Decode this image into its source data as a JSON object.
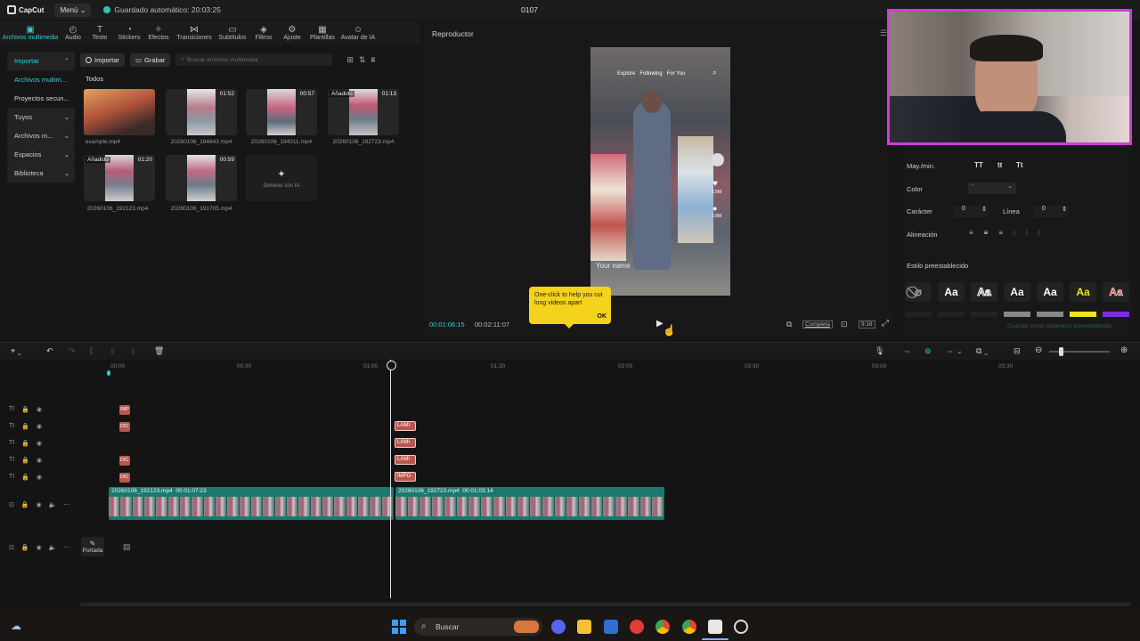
{
  "titlebar": {
    "app_name": "CapCut",
    "menu_label": "Menú",
    "autosave_text": "Guardado automático: 20:03:25",
    "project_title": "0107"
  },
  "toolbar": {
    "tools": [
      {
        "label": "Archivos multimedia",
        "icon": "media-icon"
      },
      {
        "label": "Audio",
        "icon": "audio-icon"
      },
      {
        "label": "Texto",
        "icon": "text-icon"
      },
      {
        "label": "Stickers",
        "icon": "sticker-icon"
      },
      {
        "label": "Efectos",
        "icon": "effects-icon"
      },
      {
        "label": "Transiciones",
        "icon": "transition-icon"
      },
      {
        "label": "Subtítulos",
        "icon": "subtitle-icon"
      },
      {
        "label": "Filtros",
        "icon": "filter-icon"
      },
      {
        "label": "Ajuste",
        "icon": "adjust-icon"
      },
      {
        "label": "Plantillas",
        "icon": "template-icon"
      },
      {
        "label": "Avatar de IA",
        "icon": "avatar-icon"
      }
    ]
  },
  "sidebar": {
    "import_label": "Importar",
    "media_label": "Archivos multim...",
    "secure_label": "Proyectos secun...",
    "yours_label": "Tuyos",
    "archives_label": "Archivos m...",
    "spaces_label": "Espacios",
    "library_label": "Biblioteca"
  },
  "media": {
    "import_btn": "Importar",
    "record_btn": "Grabar",
    "search_placeholder": "Buscar archivos multimedia",
    "section_label": "Todos",
    "items": [
      {
        "name": "example.mp4",
        "duration": "",
        "tag": ""
      },
      {
        "name": "20260106_194643.mp4",
        "duration": "01:52",
        "tag": ""
      },
      {
        "name": "20260106_194011.mp4",
        "duration": "00:57",
        "tag": ""
      },
      {
        "name": "20260106_192723.mp4",
        "duration": "01:13",
        "tag": "Añadido"
      },
      {
        "name": "20260106_192123.mp4",
        "duration": "01:20",
        "tag": "Añadido"
      },
      {
        "name": "20260106_191705.mp4",
        "duration": "00:59",
        "tag": ""
      }
    ],
    "generate_label": "Generar con IA"
  },
  "player": {
    "title": "Reproductor",
    "current_time": "00:01:06:15",
    "total_time": "00:02:11:07",
    "tooltip_text": "One-click to help you cut long videos apart",
    "tooltip_ok": "OK",
    "ratio_label": "Completa",
    "aspect_label": "9:16",
    "video_tabs": {
      "explore": "Explore",
      "following": "Following",
      "for_you": "For You"
    },
    "video_counts": {
      "likes": "2.8M",
      "comments": "2.8M"
    },
    "video_caption": "Your name"
  },
  "props": {
    "mayus_label": "May./min.",
    "case_options": [
      "TT",
      "tt",
      "Tt"
    ],
    "color_label": "Color",
    "char_label": "Carácter",
    "char_value": "0",
    "line_label": "Línea",
    "line_value": "0",
    "align_label": "Alineación",
    "preset_label": "Estilo preestablecido",
    "presets": [
      "Aa",
      "Aa",
      "Aa",
      "Aa",
      "Aa",
      "Aa"
    ],
    "save_preset": "Guardar como parámetro preestablecido",
    "colors": {
      "accent": "#2fd2d8",
      "clip": "#b9574f",
      "video": "#1b7a70",
      "tooltip": "#f5d21c"
    }
  },
  "timeline": {
    "ruler": [
      "00:00",
      "00:30",
      "01:00",
      "01:30",
      "02:00",
      "02:30",
      "03:00",
      "03:30"
    ],
    "clips_a": [
      "IMP",
      "DIC",
      "DIC",
      "DIC"
    ],
    "clips_b": [
      "LAMI",
      "LAMI",
      "LAMI",
      "IMPO"
    ],
    "video1": {
      "name": "20260106_192123.mp4",
      "duration": "00:01:07:23"
    },
    "video2": {
      "name": "20260106_192723.mp4",
      "duration": "00:01:03:14"
    },
    "cover_label": "Portada"
  },
  "taskbar": {
    "search_label": "Buscar"
  }
}
